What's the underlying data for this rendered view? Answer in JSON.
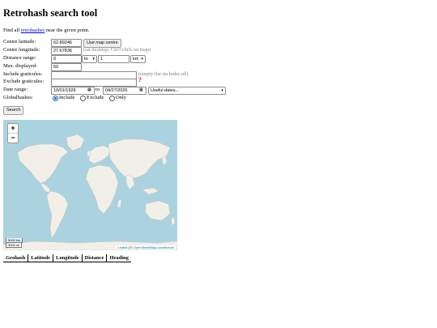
{
  "page": {
    "title": "Retrohash search tool",
    "intro_before": "Find all ",
    "intro_link": "retrohashes",
    "intro_after": " near the given point."
  },
  "form": {
    "centre_lat_label": "Centre latitude:",
    "centre_lat_value": "62.89246",
    "use_map_centre_label": "Use map centre",
    "centre_lon_label": "Centre longitude:",
    "centre_lon_value": "27.67836",
    "centre_lon_hint": "(on desktop, Ctrl+click on map)",
    "distance_label": "Distance range:",
    "distance_from": "0",
    "distance_op": "to",
    "distance_to": "1",
    "distance_unit": "km",
    "max_label": "Max. displayed:",
    "max_value": "50",
    "include_label": "Include graticules:",
    "include_value": "",
    "include_hint": "(empty list includes all)",
    "exclude_label": "Exclude graticules:",
    "exclude_value": "",
    "help_mark": "?",
    "date_label": "Date range:",
    "date_from": "10/01/1928",
    "date_to_word": "to",
    "date_to": "04/27/2026",
    "useful_dates": "Useful dates...",
    "global_label": "Globalhashes:",
    "global_options": [
      "Include",
      "Exclude",
      "Only"
    ],
    "global_selected": "Include",
    "search_label": "Search"
  },
  "map": {
    "zoom_in": "+",
    "zoom_out": "−",
    "scale_km": "5000 km",
    "scale_mi": "3000 mi",
    "attr_leaflet": "Leaflet",
    "attr_sep": " | © ",
    "attr_osm": "OpenStreetMap contributors",
    "water_color": "#aad3df",
    "land_color": "#f2efe9"
  },
  "results": {
    "headers": [
      "Geohash",
      "Latitude",
      "Longitude",
      "Distance",
      "Heading"
    ]
  }
}
